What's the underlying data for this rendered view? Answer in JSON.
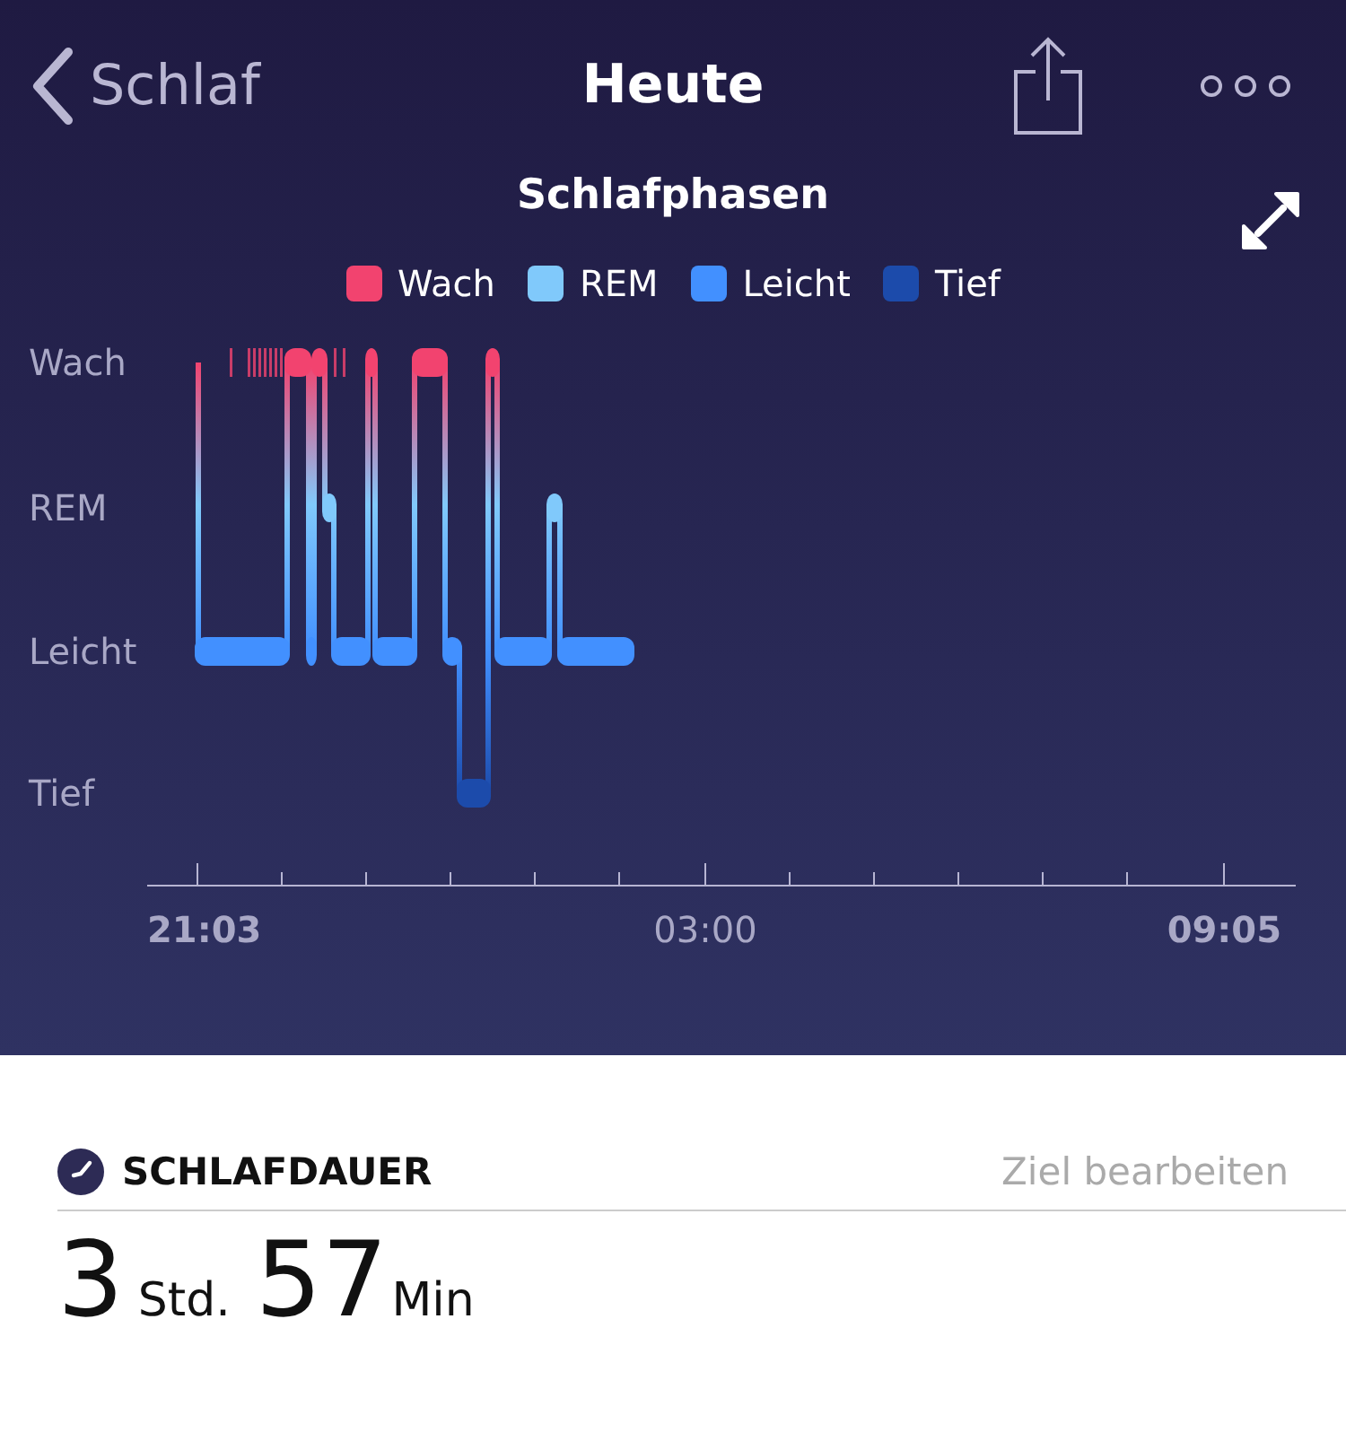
{
  "header": {
    "back": "Schlaf",
    "title": "Heute"
  },
  "chart": {
    "title": "Schlafphasen",
    "legend": [
      {
        "label": "Wach",
        "color": "#f2436f"
      },
      {
        "label": "REM",
        "color": "#80c9fb"
      },
      {
        "label": "Leicht",
        "color": "#4290ff"
      },
      {
        "label": "Tief",
        "color": "#1c4bab"
      }
    ],
    "y_labels": [
      "Wach",
      "REM",
      "Leicht",
      "Tief"
    ],
    "x_labels": [
      {
        "label": "21:03",
        "emphasized": true
      },
      {
        "label": "03:00",
        "emphasized": false
      },
      {
        "label": "09:05",
        "emphasized": true
      }
    ]
  },
  "summary": {
    "title": "SCHLAFDAUER",
    "edit_link": "Ziel bearbeiten",
    "hours": "3",
    "hours_unit": "Std.",
    "minutes": "57",
    "minutes_unit": "Min"
  }
}
